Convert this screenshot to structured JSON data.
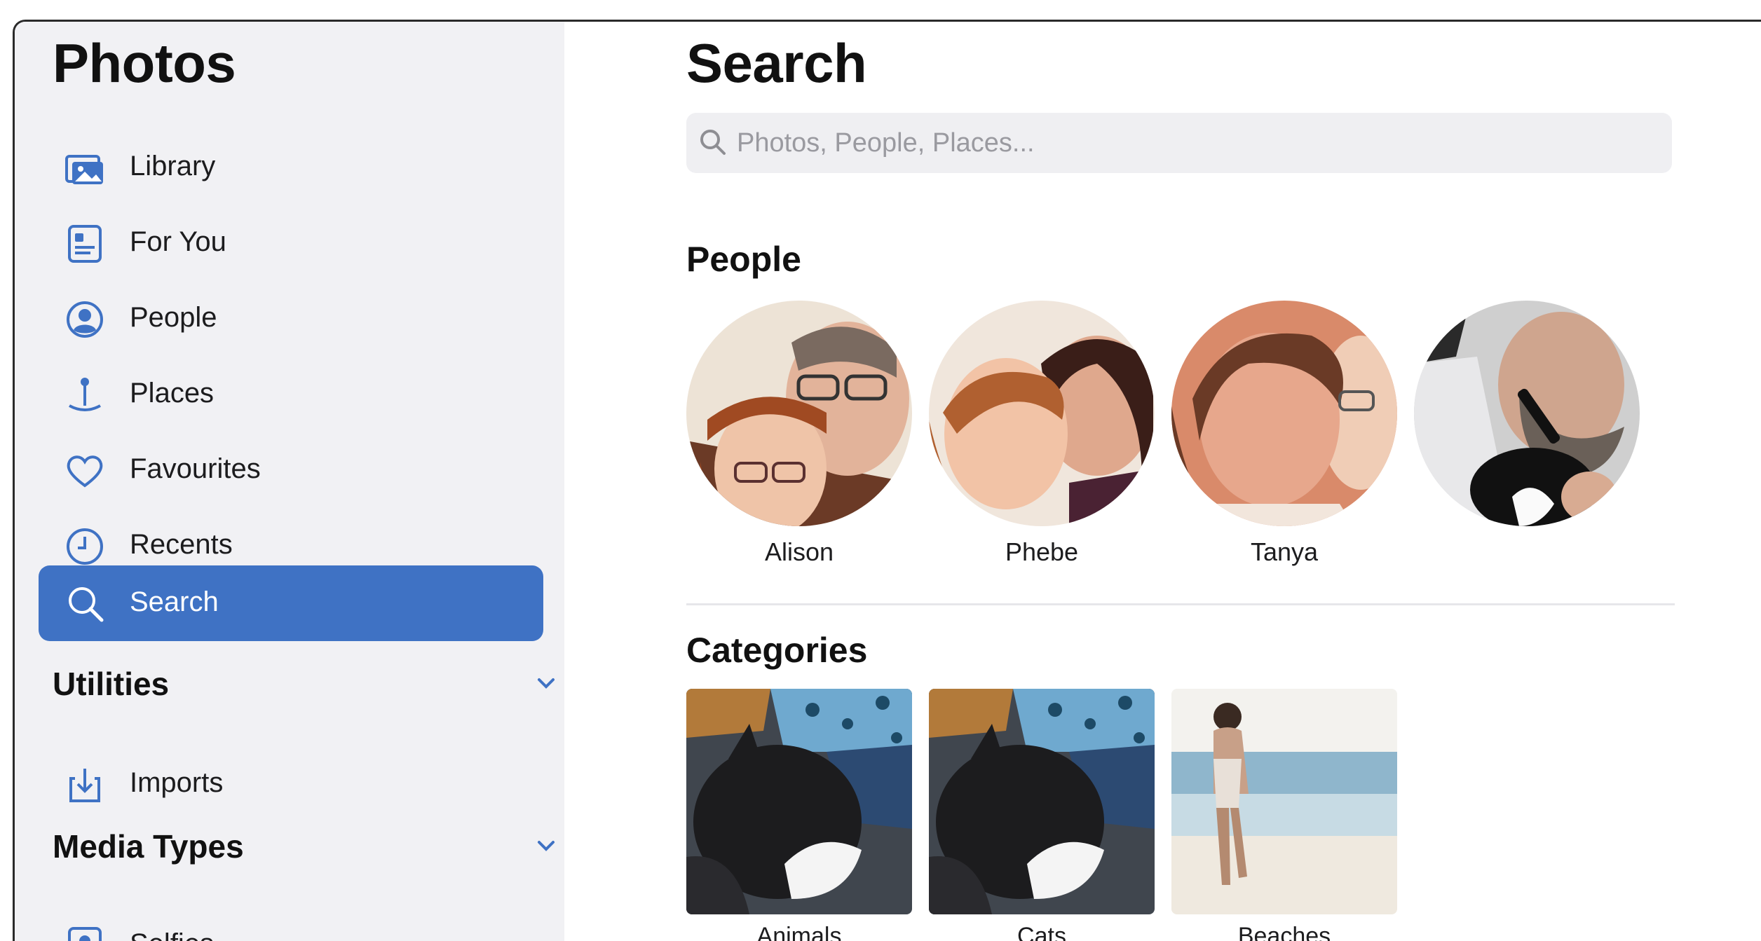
{
  "sidebar": {
    "app_title": "Photos",
    "items": [
      {
        "label": "Library",
        "icon": "photo-library-icon"
      },
      {
        "label": "For You",
        "icon": "for-you-icon"
      },
      {
        "label": "People",
        "icon": "person-circle-icon"
      },
      {
        "label": "Places",
        "icon": "map-pin-icon"
      },
      {
        "label": "Favourites",
        "icon": "heart-icon"
      },
      {
        "label": "Recents",
        "icon": "clock-icon"
      },
      {
        "label": "Search",
        "icon": "search-icon",
        "active": true
      }
    ],
    "sections": [
      {
        "title": "Utilities",
        "icon": "chevron-down-icon",
        "items": [
          {
            "label": "Imports",
            "icon": "import-icon"
          }
        ]
      },
      {
        "title": "Media Types",
        "icon": "chevron-down-icon",
        "items": [
          {
            "label": "Selfies",
            "icon": "selfie-icon"
          }
        ]
      }
    ]
  },
  "main": {
    "title": "Search",
    "search": {
      "placeholder": "Photos, People, Places..."
    },
    "people_title": "People",
    "people": [
      {
        "name": "Alison"
      },
      {
        "name": "Phebe"
      },
      {
        "name": "Tanya"
      },
      {
        "name": ""
      }
    ],
    "categories_title": "Categories",
    "categories": [
      {
        "name": "Animals"
      },
      {
        "name": "Cats"
      },
      {
        "name": "Beaches"
      }
    ]
  },
  "colors": {
    "accent": "#3f72c4",
    "sidebar_bg": "#f1f1f4",
    "icon": "#3f72c4"
  }
}
